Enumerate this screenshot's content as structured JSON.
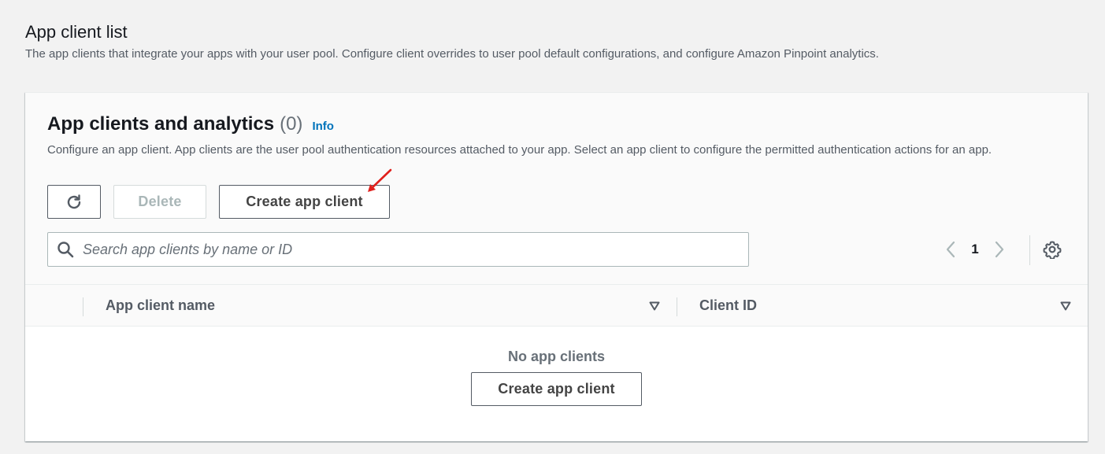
{
  "page": {
    "title": "App client list",
    "description": "The app clients that integrate your apps with your user pool. Configure client overrides to user pool default configurations, and configure Amazon Pinpoint analytics."
  },
  "container": {
    "heading": "App clients and analytics",
    "counter": "(0)",
    "info_link": "Info",
    "description": "Configure an app client. App clients are the user pool authentication resources attached to your app. Select an app client to configure the permitted authentication actions for an app."
  },
  "toolbar": {
    "refresh_icon": "refresh-icon",
    "delete_label": "Delete",
    "create_label": "Create app client"
  },
  "search": {
    "icon": "search-icon",
    "placeholder": "Search app clients by name or ID",
    "value": ""
  },
  "pagination": {
    "current_page": "1",
    "prev_icon": "chevron-left-icon",
    "next_icon": "chevron-right-icon",
    "settings_icon": "gear-icon"
  },
  "table": {
    "columns": [
      {
        "label": "App client name",
        "sort_icon": "caret-down-icon"
      },
      {
        "label": "Client ID",
        "sort_icon": "caret-down-icon"
      }
    ],
    "rows": [],
    "empty_state": {
      "title": "No app clients",
      "button_label": "Create app client"
    }
  },
  "colors": {
    "link": "#0073bb",
    "annotation": "#e0201c",
    "text_secondary": "#545b64",
    "disabled": "#aab7b8"
  }
}
